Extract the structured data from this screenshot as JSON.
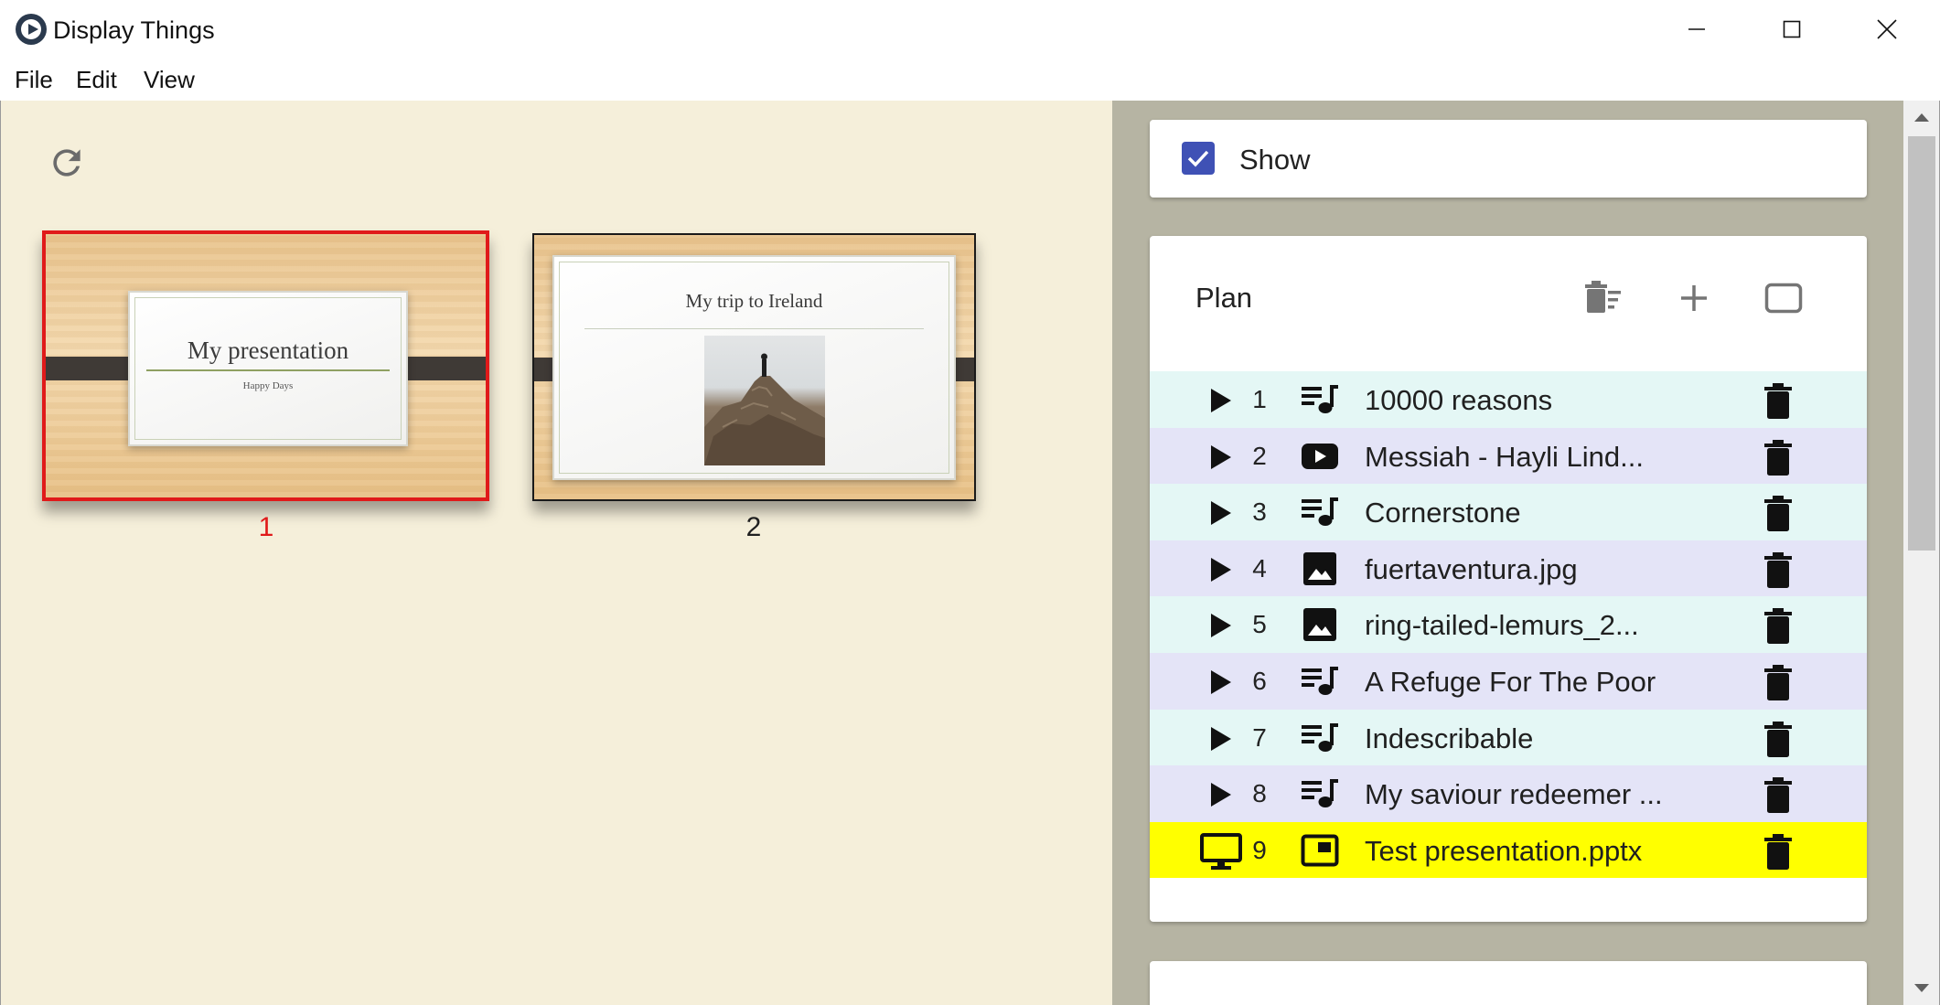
{
  "window": {
    "title": "Display Things"
  },
  "menu": {
    "file": "File",
    "edit": "Edit",
    "view": "View"
  },
  "slides": [
    {
      "number": "1",
      "title": "My presentation",
      "subtitle": "Happy Days",
      "selected": true
    },
    {
      "number": "2",
      "title": "My trip to Ireland",
      "selected": false
    }
  ],
  "colors": {
    "selected_slide": "#e01a1a",
    "accent": "#3f51b5",
    "active_row": "#ffff00",
    "row_teal": "#e4f7f5",
    "row_lavender": "#e4e4f7"
  },
  "show": {
    "label": "Show",
    "checked": true
  },
  "plan": {
    "title": "Plan",
    "tools": [
      "clear-all-icon",
      "add-icon",
      "screen-outline-icon"
    ],
    "items": [
      {
        "number": "1",
        "type": "song",
        "name": "10000 reasons"
      },
      {
        "number": "2",
        "type": "youtube",
        "name": "Messiah - Hayli Lind..."
      },
      {
        "number": "3",
        "type": "song",
        "name": "Cornerstone"
      },
      {
        "number": "4",
        "type": "image",
        "name": "fuertaventura.jpg"
      },
      {
        "number": "5",
        "type": "image",
        "name": "ring-tailed-lemurs_2..."
      },
      {
        "number": "6",
        "type": "song",
        "name": "A Refuge For The Poor"
      },
      {
        "number": "7",
        "type": "song",
        "name": "Indescribable"
      },
      {
        "number": "8",
        "type": "song",
        "name": "My saviour redeemer ..."
      },
      {
        "number": "9",
        "type": "presentation",
        "name": "Test presentation.pptx",
        "active": true
      }
    ]
  }
}
